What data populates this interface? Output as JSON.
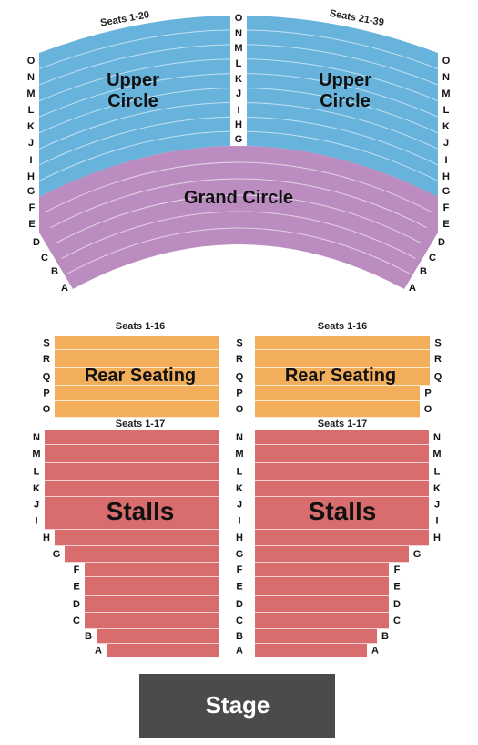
{
  "colors": {
    "upper_circle": "#67b3dc",
    "grand_circle": "#bb8cbf",
    "rear_seating": "#f3ae5c",
    "stalls": "#d96d6e",
    "stage": "#4b4b4b"
  },
  "upper_circle": {
    "name": "Upper Circle",
    "name_line1": "Upper",
    "name_line2": "Circle",
    "left_seats": "Seats 1-20",
    "right_seats": "Seats 21-39",
    "rows": [
      "O",
      "N",
      "M",
      "L",
      "K",
      "J",
      "I",
      "H",
      "G"
    ]
  },
  "grand_circle": {
    "name": "Grand Circle",
    "rows": [
      "F",
      "E",
      "D",
      "C",
      "B",
      "A"
    ]
  },
  "rear_seating": {
    "name": "Rear Seating",
    "left_seats": "Seats 1-16",
    "right_seats": "Seats 1-16",
    "rows": [
      "S",
      "R",
      "Q",
      "P",
      "O"
    ]
  },
  "stalls": {
    "name": "Stalls",
    "left_seats": "Seats 1-17",
    "right_seats": "Seats 1-17",
    "rows": [
      "N",
      "M",
      "L",
      "K",
      "J",
      "I",
      "H",
      "G",
      "F",
      "E",
      "D",
      "C",
      "B",
      "A"
    ]
  },
  "stage": {
    "label": "Stage"
  }
}
